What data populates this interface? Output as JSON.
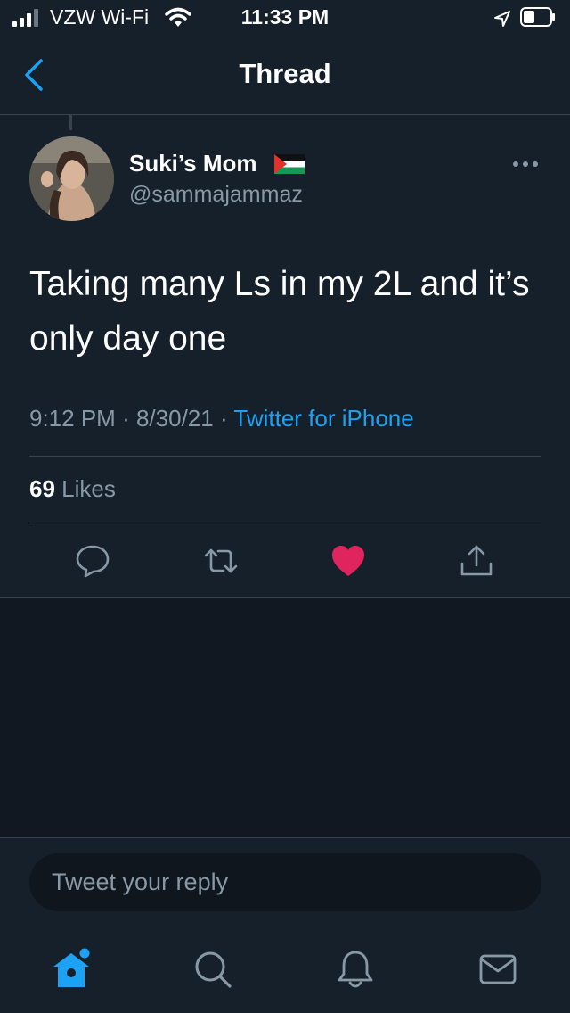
{
  "status_bar": {
    "carrier": "VZW Wi-Fi",
    "time": "11:33 PM"
  },
  "header": {
    "title": "Thread"
  },
  "tweet": {
    "display_name": "Suki’s Mom",
    "handle": "@sammajammaz",
    "text": "Taking many Ls in my 2L and it’s only day one",
    "time": "9:12 PM",
    "date": "8/30/21",
    "separator": "·",
    "source": "Twitter for iPhone",
    "likes_count": "69",
    "likes_label": "Likes",
    "liked": true
  },
  "reply": {
    "placeholder": "Tweet your reply"
  },
  "colors": {
    "background": "#15202b",
    "accent": "#1da1f2",
    "like": "#e0245e",
    "muted": "#8899a6"
  },
  "icons": {
    "actions": [
      "reply-icon",
      "retweet-icon",
      "like-icon",
      "share-icon"
    ],
    "tabs": [
      "home-icon",
      "search-icon",
      "notifications-icon",
      "messages-icon"
    ]
  }
}
